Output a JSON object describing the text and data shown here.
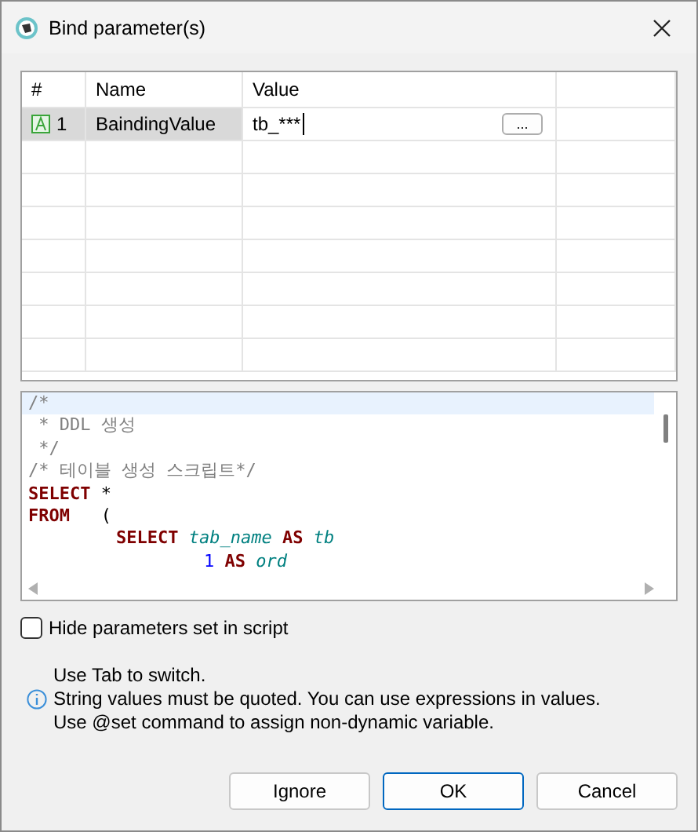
{
  "window": {
    "title": "Bind parameter(s)"
  },
  "table": {
    "columns": [
      "#",
      "Name",
      "Value"
    ],
    "rows": [
      {
        "index": "1",
        "name": "BaindingValue",
        "value": "tb_***",
        "selected": true,
        "editing": true,
        "button": "..."
      }
    ]
  },
  "script": {
    "lines": [
      {
        "current": true,
        "kind": "flush",
        "tokens": [
          {
            "kind": "comment",
            "text": "/*"
          }
        ]
      },
      {
        "current": false,
        "kind": "flush",
        "tokens": [
          {
            "kind": "comment",
            "text": " * DDL 생성"
          }
        ]
      },
      {
        "current": false,
        "kind": "flush",
        "tokens": [
          {
            "kind": "comment",
            "text": " */"
          }
        ]
      },
      {
        "current": false,
        "kind": "flush",
        "tokens": [
          {
            "kind": "comment",
            "text": "/* 테이블 생성 스크립트*/"
          }
        ]
      },
      {
        "current": false,
        "kind": "flush",
        "tokens": [
          {
            "kind": "keyword",
            "text": "SELECT"
          },
          {
            "kind": "plain",
            "text": "*"
          }
        ]
      },
      {
        "current": false,
        "kind": "flush",
        "tokens": [
          {
            "kind": "keyword",
            "text": "FROM"
          },
          {
            "kind": "plain",
            "text": "  ("
          }
        ]
      },
      {
        "current": false,
        "kind": "indented",
        "tokens": [
          {
            "kind": "keyword",
            "text": "SELECT"
          },
          {
            "kind": "ident",
            "text": "tab_name"
          },
          {
            "kind": "keyword",
            "text": "AS"
          },
          {
            "kind": "ident",
            "text": "tb"
          }
        ]
      },
      {
        "current": false,
        "kind": "continued",
        "tokens": [
          {
            "kind": "number",
            "text": "1"
          },
          {
            "kind": "keyword",
            "text": "AS"
          },
          {
            "kind": "ident",
            "text": "ord"
          }
        ]
      }
    ]
  },
  "hide_option": {
    "label": "Hide parameters set in script",
    "checked": false
  },
  "info": [
    "Use Tab to switch.",
    "String values must be quoted. You can use expressions in values.",
    "Use @set command to assign non-dynamic variable."
  ],
  "buttons": [
    {
      "label": "Ignore",
      "default": false
    },
    {
      "label": "OK",
      "default": true
    },
    {
      "label": "Cancel",
      "default": false
    }
  ]
}
